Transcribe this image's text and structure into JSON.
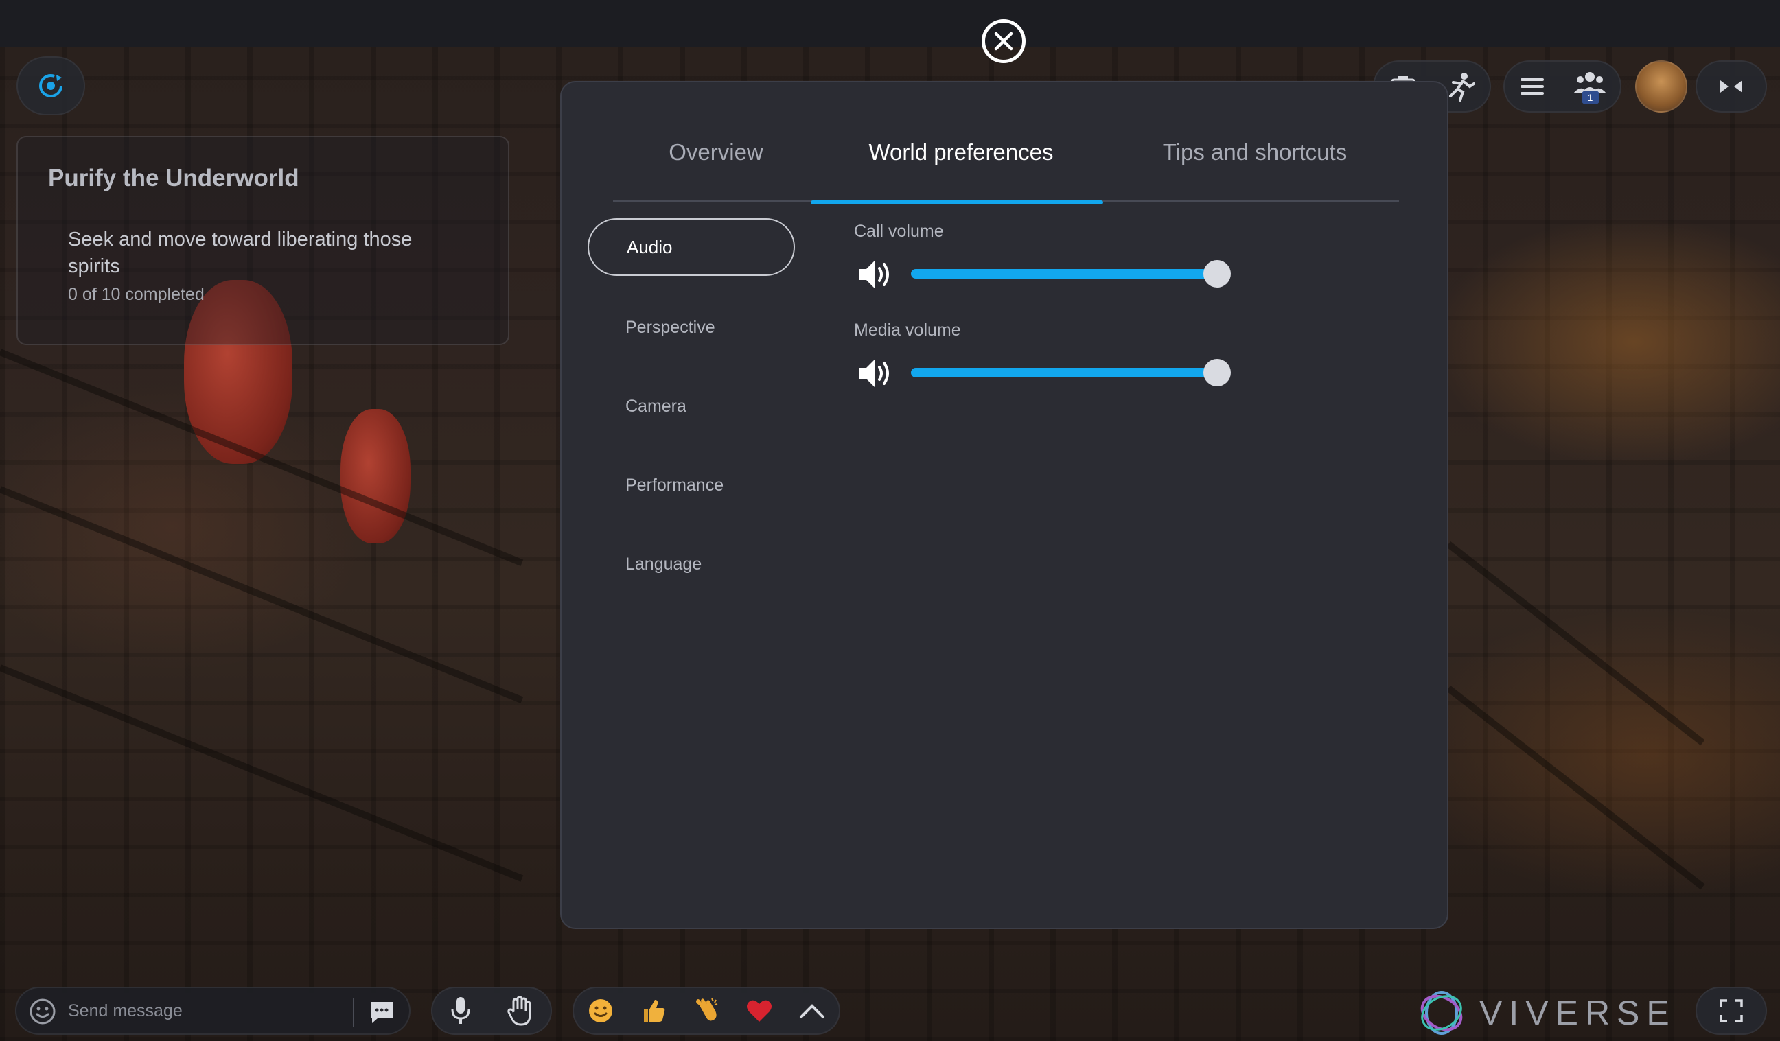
{
  "quest": {
    "title": "Purify the Underworld",
    "description": "Seek and move toward liberating those spirits",
    "progress": "0 of 10 completed"
  },
  "toolbar": {
    "participants_badge": "1"
  },
  "modal": {
    "tabs": [
      {
        "label": "Overview",
        "active": false
      },
      {
        "label": "World preferences",
        "active": true
      },
      {
        "label": "Tips and shortcuts",
        "active": false
      }
    ],
    "sidebar": [
      {
        "label": "Audio",
        "active": true
      },
      {
        "label": "Perspective",
        "active": false
      },
      {
        "label": "Camera",
        "active": false
      },
      {
        "label": "Performance",
        "active": false
      },
      {
        "label": "Language",
        "active": false
      }
    ],
    "audio": {
      "call_volume": {
        "label": "Call volume",
        "value": 1.0
      },
      "media_volume": {
        "label": "Media volume",
        "value": 1.0
      }
    }
  },
  "chat": {
    "placeholder": "Send message"
  },
  "reactions": [
    "smile-emoji",
    "thumbs-up-emoji",
    "clap-emoji",
    "heart-emoji"
  ],
  "brand": {
    "name": "VIVERSE"
  },
  "colors": {
    "accent": "#12a7ee",
    "panel": "#2b2c33",
    "topbar": "#1c1d22"
  }
}
